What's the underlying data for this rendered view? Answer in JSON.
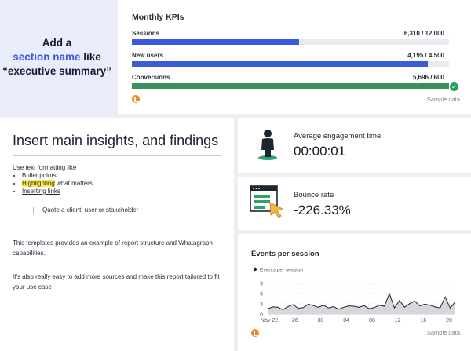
{
  "section": {
    "line1": "Add a",
    "line2_highlight": "section name",
    "line2_rest": " like",
    "line3": "“executive summary”"
  },
  "kpis": {
    "title": "Monthly KPIs",
    "rows": [
      {
        "label": "Sessions",
        "value": "6,310 / 12,000",
        "progress": 0.526,
        "color": "#3b5bdb"
      },
      {
        "label": "New users",
        "value": "4,195 / 4,500",
        "progress": 0.932,
        "color": "#3b5bdb"
      },
      {
        "label": "Conversions",
        "value": "5,696 / 600",
        "progress": 1.0,
        "color": "#3a8f5c"
      }
    ],
    "footer": "Sample data"
  },
  "insights": {
    "title": "Insert main insights, and findings",
    "intro": "Use text formatting like",
    "bullet1": "Bullet points",
    "bullet2_highlight": "Highlighting",
    "bullet2_rest": " what matters",
    "bullet3": "Inserting links",
    "quote": "Quote a client, user or stakeholder",
    "para1": "This templates provides an example of report structure and Whatagraph capabilities.",
    "para2": "It's also really easy to add more sources and make this report tailored to fit your use case"
  },
  "engagement": {
    "label": "Average engagement time",
    "value": "00:00:01",
    "icon": "person-icon"
  },
  "bounce": {
    "label": "Bounce rate",
    "value": "-226.33%",
    "icon": "browser-cursor-icon"
  },
  "events": {
    "title": "Events per session",
    "footer": "Sample data",
    "chart_data": {
      "type": "area",
      "legend": [
        "Events per session"
      ],
      "x_ticks": [
        "Nov 22",
        "26",
        "30",
        "04",
        "08",
        "12",
        "16",
        "20"
      ],
      "y_ticks": [
        0,
        3,
        6,
        9
      ],
      "ylim": [
        0,
        9
      ],
      "series": [
        {
          "name": "Events per session",
          "values": [
            1.6,
            2.1,
            2.0,
            1.3,
            2.2,
            2.8,
            1.7,
            1.9,
            2.9,
            2.5,
            2.0,
            2.6,
            1.8,
            2.2,
            1.4,
            2.0,
            2.4,
            2.3,
            2.0,
            2.5,
            1.6,
            1.9,
            2.6,
            2.3,
            6.0,
            1.8,
            4.0,
            2.0,
            3.1,
            3.8,
            2.4,
            2.9,
            2.6,
            2.1,
            1.8,
            5.0,
            1.8,
            3.6
          ]
        }
      ],
      "color": "#222222",
      "fill": "#d4d7dc"
    }
  }
}
